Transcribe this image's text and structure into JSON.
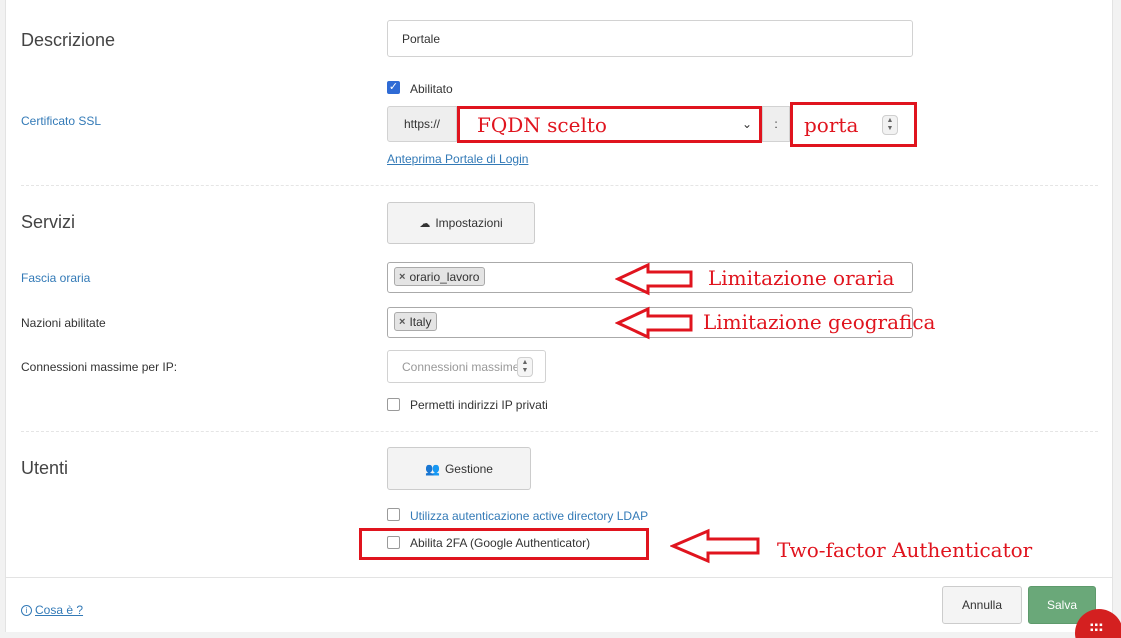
{
  "sections": {
    "descrizione": {
      "title": "Descrizione",
      "value": "Portale"
    },
    "ssl": {
      "label": "Certificato SSL",
      "enabled_label": "Abilitato",
      "enabled": true,
      "scheme": "https://",
      "fqdn_value": "FQDN scelto",
      "separator": ":",
      "port_value": "porta",
      "preview_link": "Anteprima Portale di Login"
    },
    "servizi": {
      "title": "Servizi",
      "settings_button": "Impostazioni",
      "fascia_label": "Fascia oraria",
      "fascia_tags": [
        "orario_lavoro"
      ],
      "nazioni_label": "Nazioni abilitate",
      "nazioni_tags": [
        "Italy"
      ],
      "max_conn_label": "Connessioni massime per IP:",
      "max_conn_placeholder": "Connessioni massime",
      "private_ip_label": "Permetti indirizzi IP privati",
      "private_ip_checked": false
    },
    "utenti": {
      "title": "Utenti",
      "manage_button": "Gestione",
      "ldap_label": "Utilizza autenticazione active directory LDAP",
      "ldap_checked": false,
      "twofa_label": "Abilita 2FA (Google Authenticator)",
      "twofa_checked": false
    }
  },
  "annotations": {
    "orario": "Limitazione oraria",
    "geo": "Limitazione geografica",
    "twofa": "Two-factor Authenticator"
  },
  "footer": {
    "help_link": "Cosa è ?",
    "cancel_button": "Annulla",
    "save_button": "Salva"
  },
  "colors": {
    "accent_blue": "#337ab7",
    "annotation_red": "#e0141e",
    "save_green": "#6aa879",
    "checkbox_blue": "#2f6bd5"
  }
}
